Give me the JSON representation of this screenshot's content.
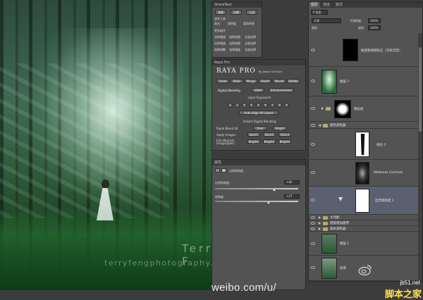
{
  "canvas": {
    "watermark_name": "Terry F",
    "watermark_site": "terryfengphotography.lofter.com"
  },
  "weibo_text": "weibo.com/u/",
  "share_panel": {
    "title": "ShareText",
    "btn1": "滚图",
    "btn2": "左移",
    "btn3": "公告",
    "section1": "修补工具",
    "row1": [
      "高光",
      "透明度",
      "柔和明亮"
    ],
    "section2": "更多插件",
    "row2": [
      "选择通道",
      "选择底图",
      "全部选择"
    ],
    "row3": [
      "选择通道",
      "选择底图",
      "全部选择"
    ],
    "row4": [
      "效果调整",
      "选择通道",
      "全部选择"
    ]
  },
  "raya": {
    "title": "Raya Pro",
    "logo": "RAYA PRO",
    "byline": "By Jimmy McIntyre",
    "tools": [
      "Undo",
      "Redo",
      "Merge",
      "Smart",
      "Decolt",
      "Delete"
    ],
    "digital_blending": "Digital Blending",
    "tab_16bit": "16Bit",
    "tab_enhance": "Enhancements",
    "layer_exposures": "Layer Exposures",
    "exposures": [
      "1",
      "2",
      "3",
      "4",
      "5",
      "6",
      "7",
      "8",
      "9"
    ],
    "auto_align": "Auto Align All Layers",
    "instant": "Instant Digital Blending",
    "rapid_blend": "Rapid Blend 16",
    "dark_label": "Dark",
    "bright_label": "Bright",
    "apply_images": "Apply Images",
    "ai_buttons": [
      "Dark1",
      "Dark2",
      "Dark3"
    ],
    "info": "Info (Normal Images/Jobs)",
    "br_buttons": [
      "Bright1",
      "Bright2",
      "Bright3"
    ]
  },
  "properties": {
    "title": "属性",
    "layer_type": "自然饱和度",
    "vibrance_label": "自然饱和度:",
    "vibrance_value": "+42",
    "saturation_label": "饱和度:",
    "saturation_value": "+27",
    "vibrance_fraction": 0.71,
    "saturation_fraction": 0.64
  },
  "layers": {
    "tabs": [
      "图层",
      "通道",
      "路径"
    ],
    "filter": "P 类型",
    "blend_mode": "正常",
    "opacity_label": "不透明度:",
    "opacity": "100%",
    "lock_label": "锁定:",
    "fill_label": "填充:",
    "fill": "100%",
    "items": [
      {
        "name": "粉佬新视频防正（可有可无）",
        "kind": "adjust"
      },
      {
        "name": "图层 7",
        "kind": "pixel"
      },
      {
        "name": "暗化处",
        "kind": "group_mask"
      },
      {
        "name": "颜色调色器",
        "kind": "group"
      },
      {
        "name": "色阶 2",
        "kind": "adjust"
      },
      {
        "name": "Midtones Contrast",
        "kind": "adjust"
      },
      {
        "name": "自然饱和度 1",
        "kind": "adjust"
      },
      {
        "name": "大功能",
        "kind": "group"
      },
      {
        "name": "感度增加使用",
        "kind": "group"
      },
      {
        "name": "基本调色器",
        "kind": "group"
      },
      {
        "name": "图层 1",
        "kind": "pixel"
      },
      {
        "name": "背景",
        "kind": "pixel"
      }
    ]
  },
  "site": {
    "domain": "jb51.net",
    "name": "脚本之家"
  }
}
